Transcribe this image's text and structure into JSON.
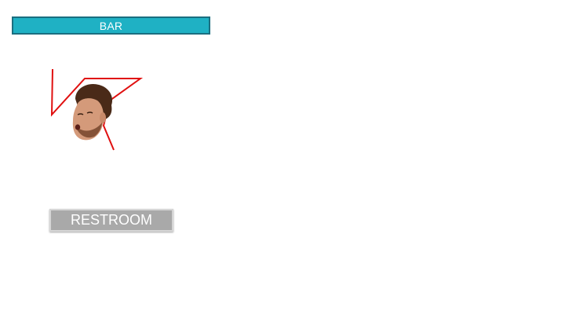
{
  "labels": {
    "bar": "BAR",
    "restroom": "RESTROOM"
  },
  "colors": {
    "bar_fill": "#1fb1c4",
    "restroom_fill": "#a9a9a9",
    "route_stroke": "#e01010",
    "label_text": "#ffffff"
  },
  "icons": {
    "person": "face-cutout"
  }
}
